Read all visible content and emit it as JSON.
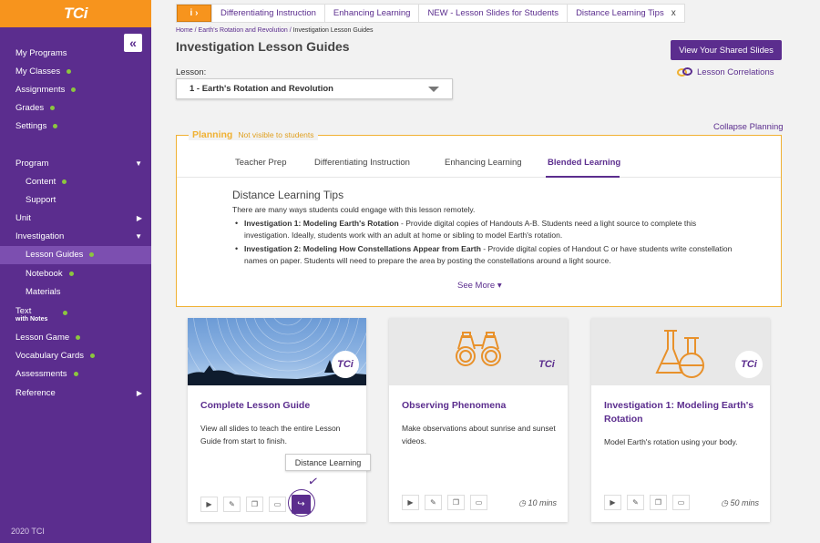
{
  "sidebar": {
    "logo": "TCi",
    "collapse_icon": "«",
    "items": [
      {
        "label": "My Programs"
      },
      {
        "label": "My Classes"
      },
      {
        "label": "Assignments"
      },
      {
        "label": "Grades"
      },
      {
        "label": "Settings"
      },
      {
        "label": "Program"
      },
      {
        "label": "Content"
      },
      {
        "label": "Support"
      },
      {
        "label": "Unit"
      },
      {
        "label": "Investigation"
      },
      {
        "label": "Lesson Guides"
      },
      {
        "label": "Notebook"
      },
      {
        "label": "Materials"
      },
      {
        "label": "Text",
        "sub": "with Notes"
      },
      {
        "label": "Lesson Game"
      },
      {
        "label": "Vocabulary Cards"
      },
      {
        "label": "Assessments"
      },
      {
        "label": "Reference"
      }
    ],
    "footer": "2020 TCI",
    "dot_color": "#8cc63f"
  },
  "topbar": {
    "info_label": "i ›",
    "tabs": [
      {
        "label": "Differentiating Instruction"
      },
      {
        "label": "Enhancing Learning"
      },
      {
        "label": "NEW - Lesson Slides for Students"
      },
      {
        "label": "Distance Learning Tips"
      }
    ],
    "close_label": "x"
  },
  "breadcrumb": {
    "home": "Home",
    "unit": "Earth's Rotation and Revolution",
    "current": "Investigation Lesson Guides"
  },
  "page": {
    "title": "Investigation Lesson Guides",
    "shared_slides_button": "View Your Shared Slides",
    "correlations_link": "Lesson Correlations",
    "lesson_label": "Lesson:",
    "lesson_value": "1 - Earth's Rotation and Revolution",
    "collapse_planning": "Collapse Planning"
  },
  "planning": {
    "title": "Planning",
    "subtitle": "Not visible to students",
    "tabs": [
      {
        "label": "Teacher Prep"
      },
      {
        "label": "Differentiating Instruction"
      },
      {
        "label": "Enhancing Learning"
      },
      {
        "label": "Blended Learning"
      }
    ],
    "active_tab": "Blended Learning",
    "heading": "Distance Learning Tips",
    "intro": "There are many ways students could engage with this lesson remotely.",
    "bullets": [
      {
        "bold": "Investigation 1: Modeling Earth's Rotation",
        "text": " - Provide digital copies of Handouts A-B. Students need a light source to complete this investigation. Ideally, students work with an adult at home or sibling to model Earth's rotation."
      },
      {
        "bold": "Investigation 2: Modeling How Constellations Appear from Earth",
        "text": " - Provide digital copies of Handout C or have students write constellation names on paper. Students will need to prepare the area by posting the constellations around a light source."
      }
    ],
    "see_more": "See More ▾"
  },
  "cards": [
    {
      "title": "Complete Lesson Guide",
      "desc": "View all slides to teach the entire Lesson Guide from start to finish.",
      "duration": "",
      "badge": "TCi"
    },
    {
      "title": "Observing Phenomena",
      "desc": "Make observations about sunrise and sunset videos.",
      "duration": "10 mins",
      "badge": "TCi"
    },
    {
      "title": "Investigation 1: Modeling Earth's Rotation",
      "desc": "Model Earth's rotation using your body.",
      "duration": "50 mins",
      "badge": "TCi"
    }
  ],
  "tooltip": "Distance Learning",
  "colors": {
    "brand_purple": "#5b2d8e",
    "brand_orange": "#f7941d",
    "planning_gold": "#f0b133"
  }
}
